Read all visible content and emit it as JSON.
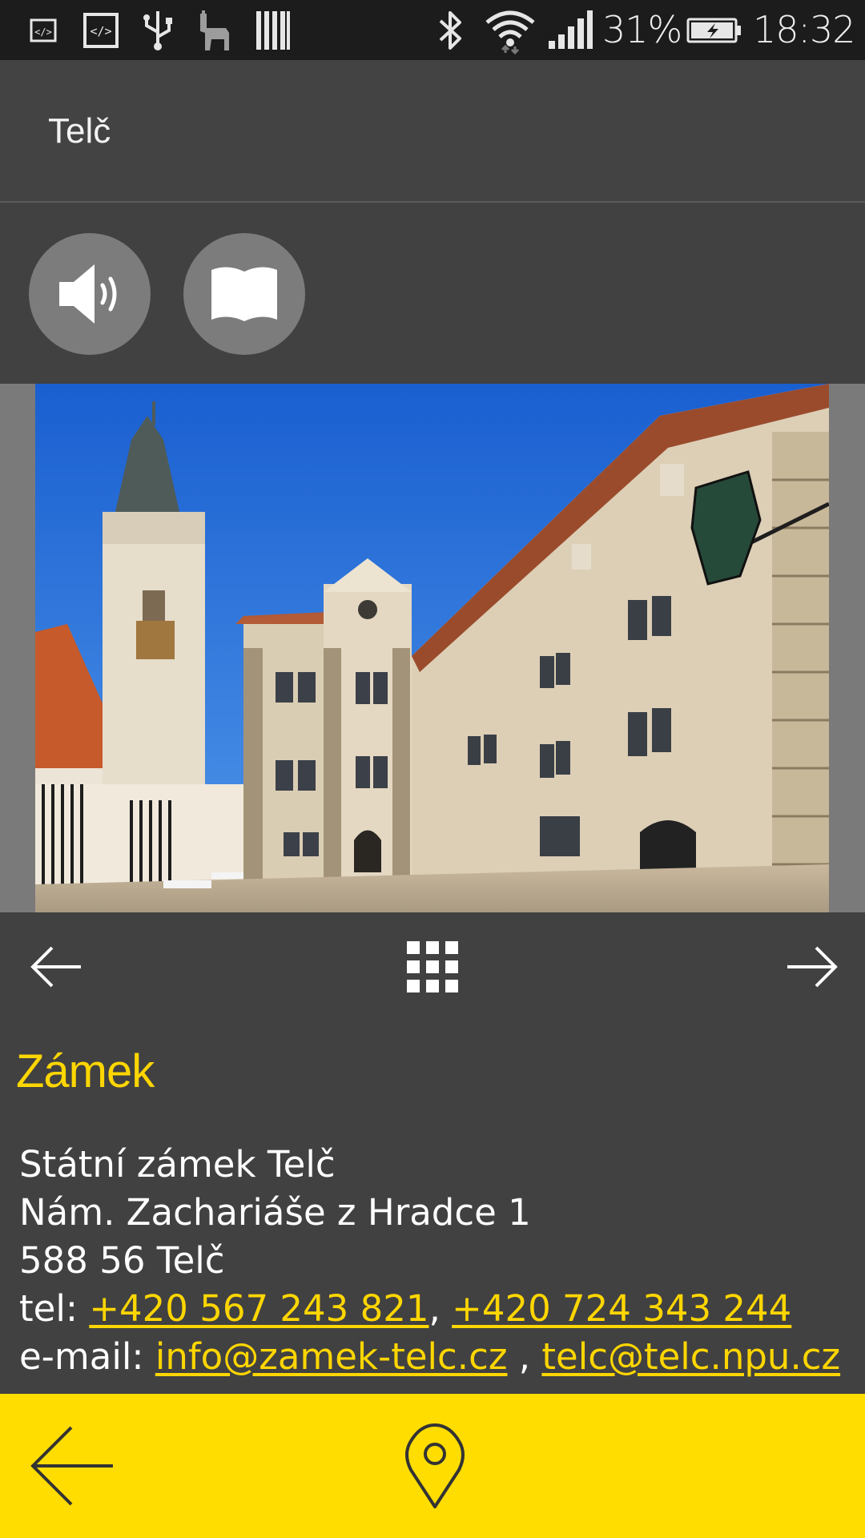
{
  "status_bar": {
    "icons": [
      "code-icon",
      "code-box-icon",
      "usb-icon",
      "llama-icon",
      "barcode-icon",
      "bluetooth-icon",
      "wifi-icon",
      "signal-icon",
      "battery-charging-icon"
    ],
    "battery": "31%",
    "time": "18:32"
  },
  "action_bar": {
    "title": "Telč"
  },
  "media": {
    "buttons": [
      "audio-icon",
      "book-icon"
    ]
  },
  "pager": {
    "prev": "arrow-left-icon",
    "grid": "grid-icon",
    "next": "arrow-right-icon"
  },
  "place": {
    "title": "Zámek",
    "name": "Státní zámek Telč",
    "street": "Nám. Zachariáše z Hradce 1",
    "city": "588 56 Telč",
    "tel_label": "tel: ",
    "tel1": "+420 567 243 821",
    "tel_sep": ", ",
    "tel2": "+420 724 343 244",
    "email_label": "e-mail: ",
    "email1": "info@zamek-telc.cz",
    "email_sep": " , ",
    "email2": "telc@telc.npu.cz"
  },
  "bottom_bar": {
    "back": "arrow-left-icon",
    "map": "map-pin-icon"
  },
  "colors": {
    "accent": "#ffd600",
    "bottom_bar": "#ffdd00",
    "background": "#414141"
  }
}
